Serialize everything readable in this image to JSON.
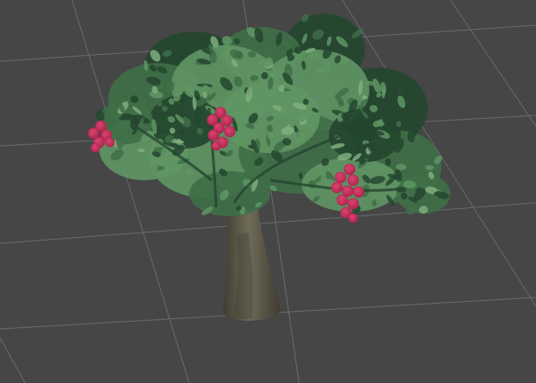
{
  "viewport": {
    "background": "#464646",
    "grid_color": "#6a6a6a",
    "grid_visible": true
  },
  "scene": {
    "object": "tree",
    "colors": {
      "trunk_dark": "#3f3b31",
      "trunk_light": "#6f6b58",
      "foliage_dark": "#24462f",
      "foliage_mid": "#3f6f48",
      "foliage_light": "#5f9564",
      "foliage_highlight": "#7fae7c",
      "berry": "#b0244f",
      "berry_highlight": "#d8456f"
    },
    "berry_clusters": 3
  }
}
